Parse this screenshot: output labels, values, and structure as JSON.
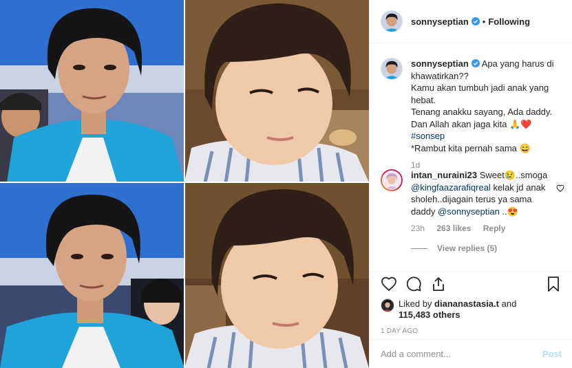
{
  "post": {
    "username": "sonnyseptian",
    "separator": "•",
    "follow_state": "Following"
  },
  "caption": {
    "username": "sonnyseptian",
    "line1": "Apa yang harus di khawatirkan??",
    "line2": "Kamu akan tumbuh jadi anak yang hebat.",
    "line3": "Tenang anakku sayang, Ada daddy.",
    "line4": "Dan Allah akan jaga kita 🙏❤️",
    "hashtag": "#sonsep",
    "line5": "*Rambut kita pernah sama 😄",
    "age": "1d"
  },
  "comment": {
    "username": "intan_nuraini23",
    "text1": "Sweet😢..smoga",
    "mention1": "@kingfaazarafiqreal",
    "text2": "kelak jd anak sholeh..dijagain terus ya sama daddy",
    "mention2": "@sonnyseptian",
    "text3": "..😍",
    "age": "23h",
    "likes": "263 likes",
    "reply": "Reply",
    "view_replies": "View replies (5)"
  },
  "likes": {
    "prefix": "Liked by",
    "user": "diananastasia.t",
    "and": "and",
    "count": "115,483 others"
  },
  "timestamp": "1 DAY AGO",
  "add_comment": {
    "placeholder": "Add a comment...",
    "post_label": "Post"
  },
  "icons": {
    "verified": "verified-badge-icon",
    "like": "heart-icon",
    "comment": "comment-bubble-icon",
    "share": "share-icon",
    "save": "bookmark-icon"
  },
  "colors": {
    "link": "#00376b",
    "muted": "#8e8e8e",
    "verified": "#3897f0",
    "post_disabled": "#b2dffc",
    "heart": "#ed4956"
  }
}
